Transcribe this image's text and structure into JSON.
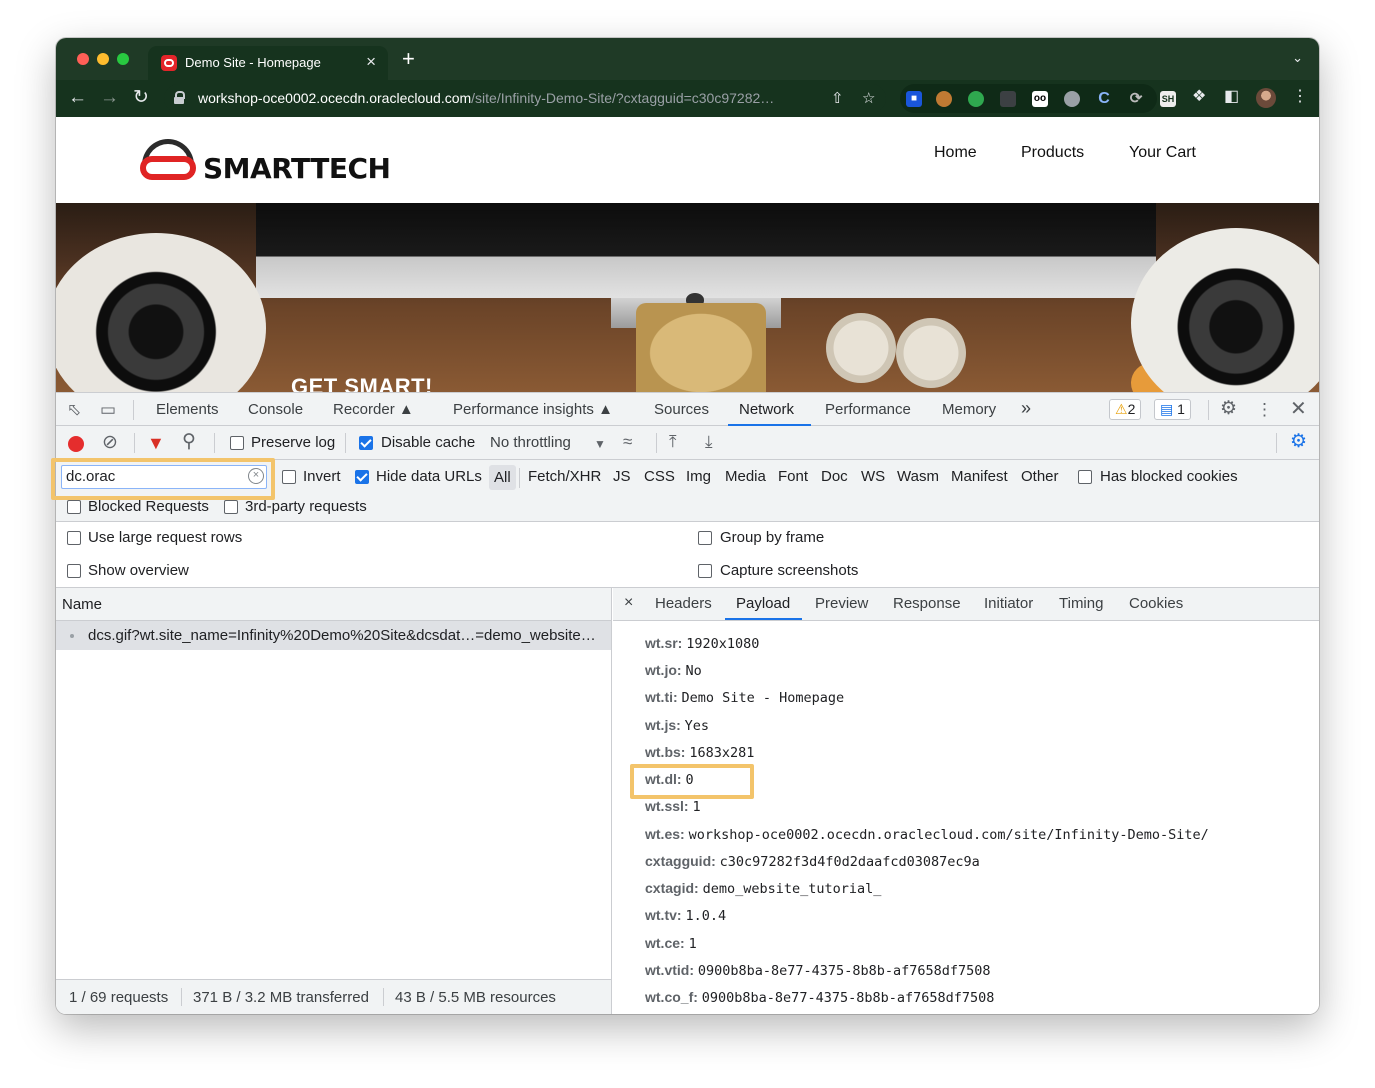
{
  "browser": {
    "tab_title": "Demo Site - Homepage",
    "url_host": "workshop-oce0002.ocecdn.oraclecloud.com",
    "url_rest": "/site/Infinity-Demo-Site/?cxtagguid=c30c97282…",
    "colors": {
      "frame": "#1f3a26",
      "toolbar": "#16331e"
    }
  },
  "site": {
    "logo_text": "SMARTTECH",
    "nav": [
      "Home",
      "Products",
      "Your Cart"
    ],
    "hero_caption": "GET SMART!"
  },
  "devtools": {
    "tabs": [
      "Elements",
      "Console",
      "Recorder",
      "Performance insights",
      "Sources",
      "Network",
      "Performance",
      "Memory"
    ],
    "more": "»",
    "warnings": "2",
    "messages": "1",
    "network": {
      "preserve_log": "Preserve log",
      "disable_cache": "Disable cache",
      "throttling": "No throttling",
      "filter_value": "dc.orac",
      "invert": "Invert",
      "hide_data_urls": "Hide data URLs",
      "types": [
        "All",
        "Fetch/XHR",
        "JS",
        "CSS",
        "Img",
        "Media",
        "Font",
        "Doc",
        "WS",
        "Wasm",
        "Manifest",
        "Other"
      ],
      "has_blocked_cookies": "Has blocked cookies",
      "blocked_requests": "Blocked Requests",
      "third_party": "3rd-party requests",
      "large_rows": "Use large request rows",
      "group_by_frame": "Group by frame",
      "show_overview": "Show overview",
      "capture_screenshots": "Capture screenshots",
      "name_header": "Name",
      "request": "dcs.gif?wt.site_name=Infinity%20Demo%20Site&dcsdat…=demo_website…",
      "status": [
        "1 / 69 requests",
        "371 B / 3.2 MB transferred",
        "43 B / 5.5 MB resources"
      ]
    },
    "detail": {
      "close": "×",
      "tabs": [
        "Headers",
        "Payload",
        "Preview",
        "Response",
        "Initiator",
        "Timing",
        "Cookies"
      ],
      "payload": [
        {
          "k": "wt.sr:",
          "v": "1920x1080"
        },
        {
          "k": "wt.jo:",
          "v": "No"
        },
        {
          "k": "wt.ti:",
          "v": "Demo Site - Homepage"
        },
        {
          "k": "wt.js:",
          "v": "Yes"
        },
        {
          "k": "wt.bs:",
          "v": "1683x281"
        },
        {
          "k": "wt.dl:",
          "v": "0"
        },
        {
          "k": "wt.ssl:",
          "v": "1"
        },
        {
          "k": "wt.es:",
          "v": "workshop-oce0002.ocecdn.oraclecloud.com/site/Infinity-Demo-Site/"
        },
        {
          "k": "cxtagguid:",
          "v": "c30c97282f3d4f0d2daafcd03087ec9a"
        },
        {
          "k": "cxtagid:",
          "v": "demo_website_tutorial_"
        },
        {
          "k": "wt.tv:",
          "v": "1.0.4"
        },
        {
          "k": "wt.ce:",
          "v": "1"
        },
        {
          "k": "wt.vtid:",
          "v": "0900b8ba-8e77-4375-8b8b-af7658df7508"
        },
        {
          "k": "wt.co_f:",
          "v": "0900b8ba-8e77-4375-8b8b-af7658df7508"
        }
      ]
    }
  },
  "accent": "#1a73e8",
  "highlight": "#f3c46b"
}
